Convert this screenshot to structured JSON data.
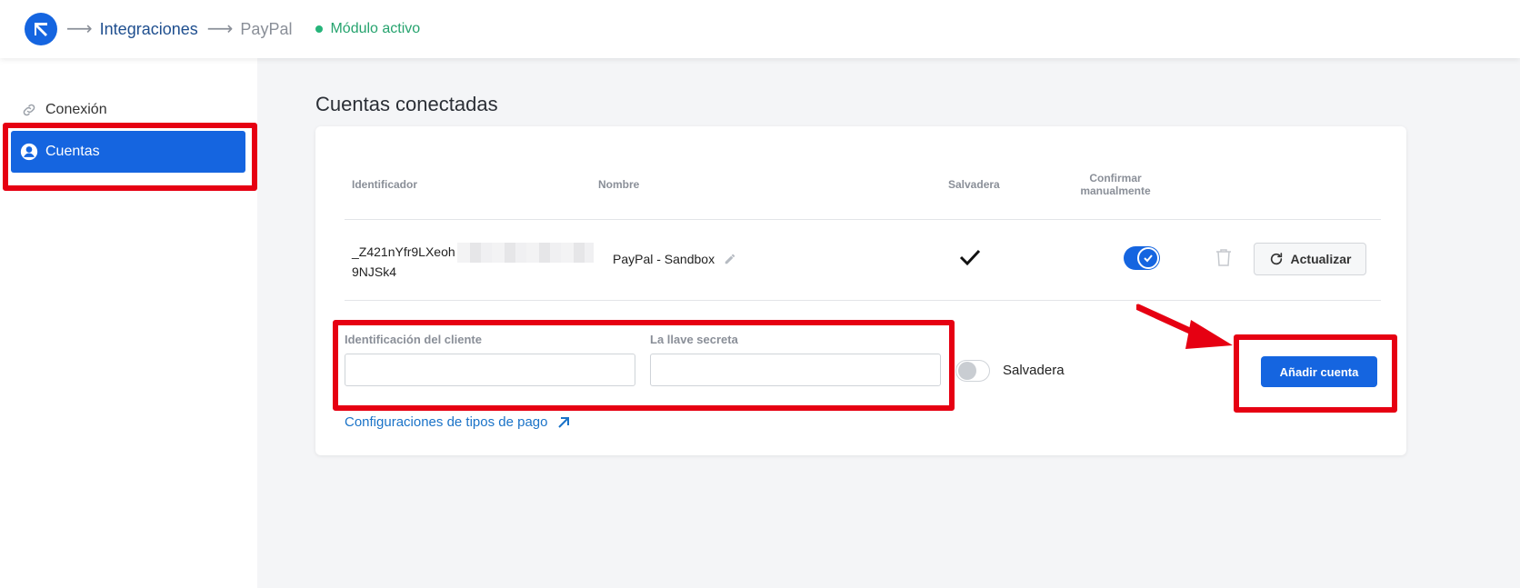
{
  "breadcrumb": {
    "integrations": "Integraciones",
    "current": "PayPal",
    "status": "Módulo activo"
  },
  "sidebar": {
    "items": [
      {
        "label": "Conexión",
        "icon": "link-icon"
      },
      {
        "label": "Cuentas",
        "icon": "user-circle-icon",
        "active": true
      }
    ]
  },
  "main": {
    "title": "Cuentas conectadas",
    "table": {
      "headers": {
        "id": "Identificador",
        "name": "Nombre",
        "sandbox": "Salvadera",
        "confirm": "Confirmar manualmente"
      },
      "rows": [
        {
          "id_line1": "_Z421nYfr9LXeoh",
          "id_line2": "9NJSk4",
          "name": "PayPal - Sandbox",
          "sandbox": true,
          "confirm_manually": true,
          "refresh_label": "Actualizar"
        }
      ]
    },
    "form": {
      "client_id_label": "Identificación del cliente",
      "client_id_value": "",
      "secret_label": "La llave secreta",
      "secret_value": "",
      "sandbox_label": "Salvadera",
      "sandbox_on": false,
      "add_label": "Añadir cuenta",
      "payment_types_link": "Configuraciones de tipos de pago"
    }
  },
  "colors": {
    "primary": "#1565e0",
    "success": "#26b47a",
    "annotation": "#e60012",
    "link": "#1a73c8"
  }
}
